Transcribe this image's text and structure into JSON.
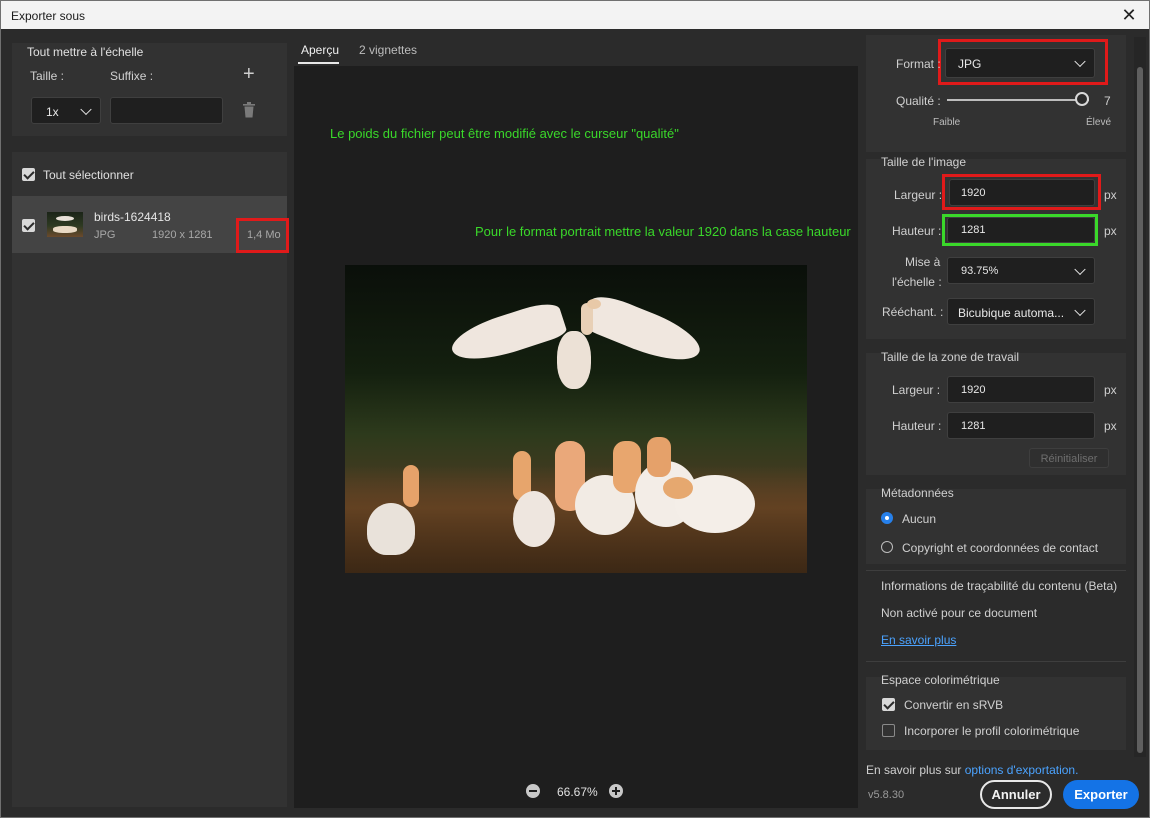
{
  "window": {
    "title": "Exporter sous",
    "close": "✕"
  },
  "scale_all": {
    "heading": "Tout mettre à l'échelle",
    "size_label": "Taille :",
    "suffix_label": "Suffixe :",
    "size_value": "1x",
    "suffix_value": "",
    "add": "+"
  },
  "assets": {
    "select_all": "Tout sélectionner",
    "item": {
      "name": "birds-1624418",
      "format": "JPG",
      "dimensions": "1920 x 1281",
      "size": "1,4 Mo"
    }
  },
  "tabs": {
    "preview": "Aperçu",
    "thumbnails": "2 vignettes"
  },
  "notes": {
    "quality": "Le poids du fichier peut être modifié avec le curseur \"qualité\"",
    "portrait": "Pour le format portrait mettre la valeur 1920 dans  la case hauteur"
  },
  "zoom": {
    "value": "66.67%"
  },
  "settings": {
    "format_label": "Format :",
    "format_value": "JPG",
    "quality_label": "Qualité :",
    "quality_value": "7",
    "quality_fraction": 1.0,
    "quality_low": "Faible",
    "quality_high": "Élevé",
    "image_size": {
      "heading": "Taille de l'image",
      "width_label": "Largeur :",
      "width_value": "1920",
      "height_label": "Hauteur :",
      "height_value": "1281",
      "unit": "px",
      "scale_label_1": "Mise à",
      "scale_label_2": "l'échelle :",
      "scale_value": "93.75%",
      "resample_label": "Rééchant. :",
      "resample_value": "Bicubique automa..."
    },
    "canvas_size": {
      "heading": "Taille de la zone de travail",
      "width_label": "Largeur :",
      "width_value": "1920",
      "height_label": "Hauteur :",
      "height_value": "1281",
      "unit": "px",
      "reset": "Réinitialiser"
    },
    "metadata": {
      "heading": "Métadonnées",
      "none": "Aucun",
      "copyright": "Copyright et coordonnées de contact"
    },
    "provenance": {
      "heading": "Informations de traçabilité du contenu (Beta)",
      "status": "Non activé pour ce document",
      "link": "En savoir plus"
    },
    "color_space": {
      "heading": "Espace colorimétrique",
      "convert": "Convertir en sRVB",
      "embed": "Incorporer le profil colorimétrique"
    }
  },
  "footer": {
    "learn_more": "En savoir plus sur",
    "options_link": "options d'exportation.",
    "version": "v5.8.30",
    "cancel": "Annuler",
    "export": "Exporter"
  },
  "colors": {
    "accent": "#1473e6",
    "link": "#4ba3ff",
    "annotation_red": "#e01a1a",
    "annotation_green": "#3ad82a"
  }
}
